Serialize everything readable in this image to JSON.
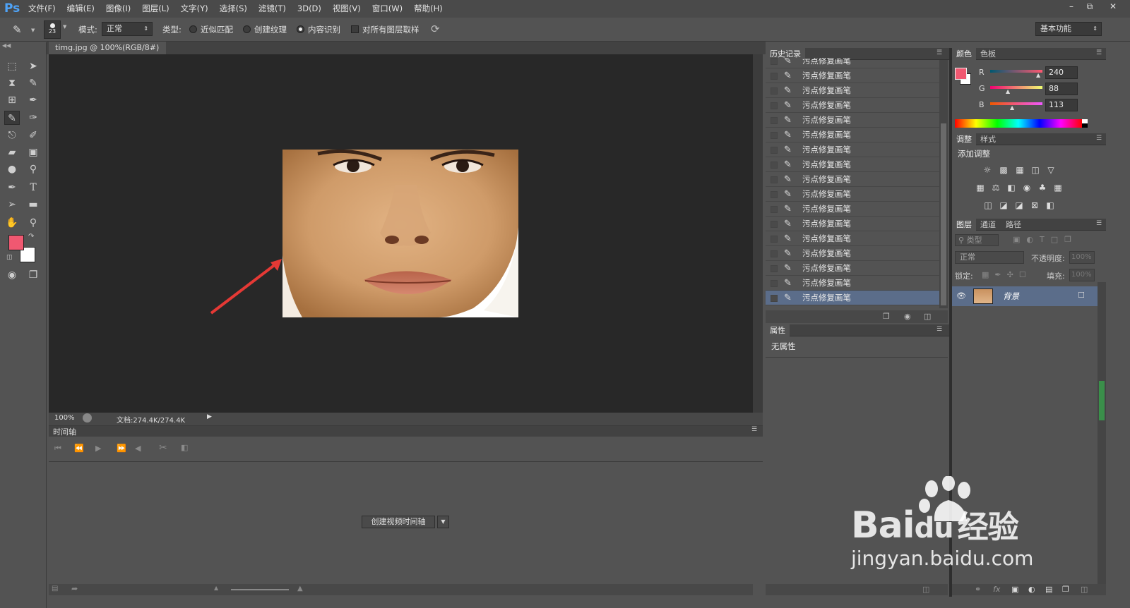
{
  "app": {
    "logo": "Ps",
    "workspace": "基本功能"
  },
  "menu": [
    "文件(F)",
    "编辑(E)",
    "图像(I)",
    "图层(L)",
    "文字(Y)",
    "选择(S)",
    "滤镜(T)",
    "3D(D)",
    "视图(V)",
    "窗口(W)",
    "帮助(H)"
  ],
  "options": {
    "brush_size": "23",
    "mode_label": "模式:",
    "mode_value": "正常",
    "type_label": "类型:",
    "radio_proximity": "近似匹配",
    "radio_texture": "创建纹理",
    "radio_content": "内容识别",
    "sample_all": "对所有图层取样"
  },
  "document": {
    "tab_title": "timg.jpg @ 100%(RGB/8#) *",
    "zoom": "100%",
    "doc_info": "文档:274.4K/274.4K"
  },
  "timeline": {
    "title": "时间轴",
    "create_button": "创建视频时间轴"
  },
  "history": {
    "tab": "历史记录",
    "items": [
      "污点修复画笔",
      "污点修复画笔",
      "污点修复画笔",
      "污点修复画笔",
      "污点修复画笔",
      "污点修复画笔",
      "污点修复画笔",
      "污点修复画笔",
      "污点修复画笔",
      "污点修复画笔",
      "污点修复画笔",
      "污点修复画笔",
      "污点修复画笔",
      "污点修复画笔",
      "污点修复画笔",
      "污点修复画笔",
      "污点修复画笔"
    ]
  },
  "properties": {
    "tab": "属性",
    "empty_text": "无属性"
  },
  "color_panel": {
    "tabs": [
      "颜色",
      "色板"
    ],
    "r_label": "R",
    "g_label": "G",
    "b_label": "B",
    "r": "240",
    "g": "88",
    "b": "113",
    "foreground": "#f05871",
    "background": "#ffffff"
  },
  "adjustments": {
    "tabs": [
      "调整",
      "样式"
    ],
    "title": "添加调整"
  },
  "layers": {
    "tabs": [
      "图层",
      "通道",
      "路径"
    ],
    "filter_kind": "类型",
    "blend_mode": "正常",
    "opacity_label": "不透明度:",
    "opacity_value": "100%",
    "lock_label": "锁定:",
    "fill_label": "填充:",
    "fill_value": "100%",
    "layer_name": "背景"
  },
  "watermark": {
    "brand": "Bai",
    "brand2": "du",
    "cn": "经验",
    "url": "jingyan.baidu.com"
  }
}
